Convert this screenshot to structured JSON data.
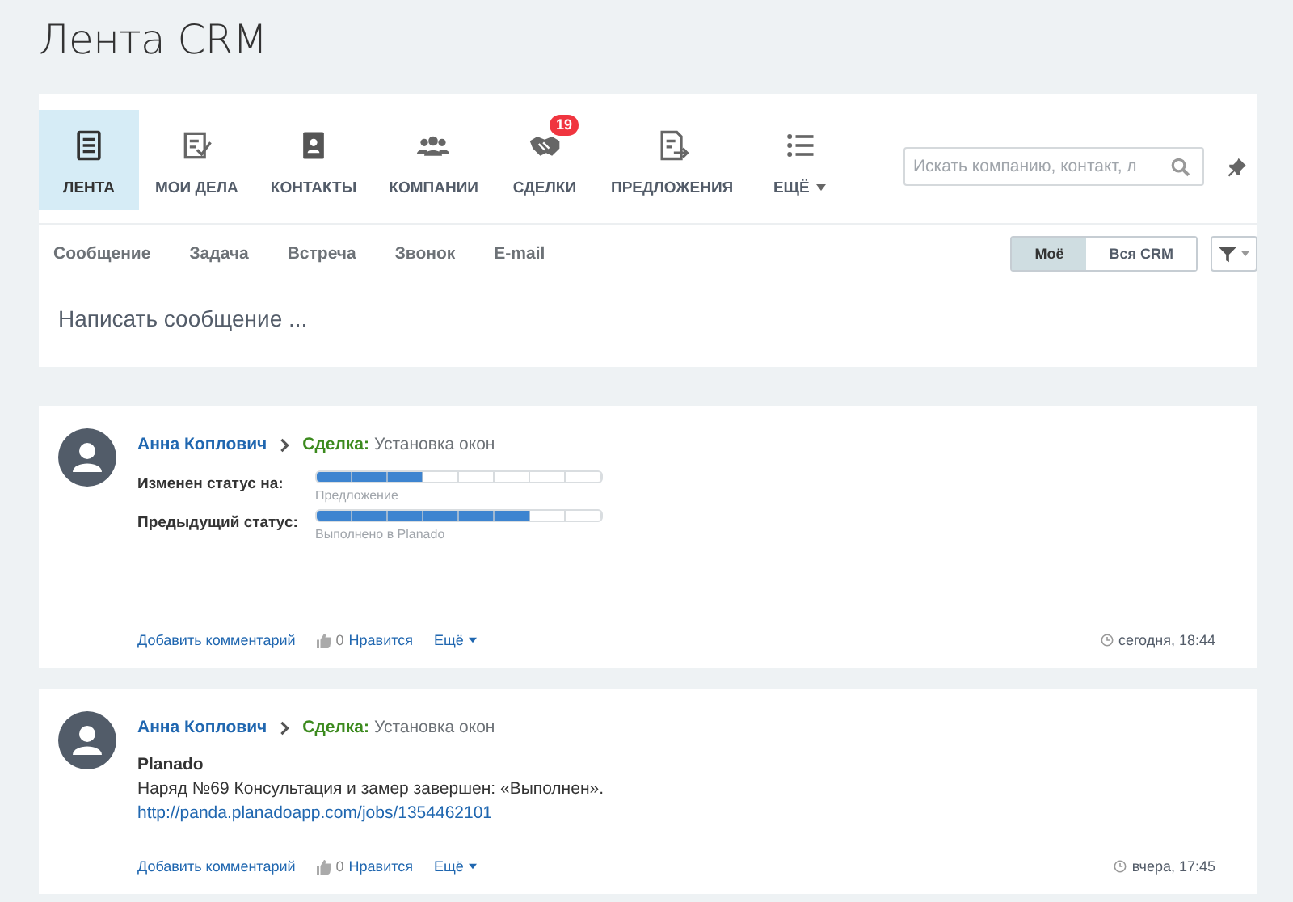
{
  "page_title": "Лента CRM",
  "nav": [
    {
      "label": "ЛЕНТА",
      "selected": true
    },
    {
      "label": "МОИ ДЕЛА",
      "selected": false
    },
    {
      "label": "КОНТАКТЫ",
      "selected": false
    },
    {
      "label": "КОМПАНИИ",
      "selected": false
    },
    {
      "label": "СДЕЛКИ",
      "selected": false,
      "badge": "19"
    },
    {
      "label": "ПРЕДЛОЖЕНИЯ",
      "selected": false
    },
    {
      "label": "ЕЩЁ",
      "selected": false,
      "dropdown": true
    }
  ],
  "search": {
    "placeholder": "Искать компанию, контакт, л"
  },
  "composer_tabs": [
    "Сообщение",
    "Задача",
    "Встреча",
    "Звонок",
    "E-mail"
  ],
  "scope": [
    {
      "label": "Моё",
      "selected": true
    },
    {
      "label": "Вся CRM",
      "selected": false
    }
  ],
  "composer": {
    "placeholder": "Написать сообщение ..."
  },
  "posts": [
    {
      "kind": "status",
      "author": "Анна Коплович",
      "entity_type": "Сделка:",
      "entity_name": "Установка окон",
      "statuses": [
        {
          "label": "Изменен статус на:",
          "level": 0.375,
          "name": "Предложение"
        },
        {
          "label": "Предыдущий статус:",
          "level": 0.75,
          "name": "Выполнено в Planado"
        }
      ],
      "comment": "Добавить комментарий",
      "likes": "0",
      "like": "Нравится",
      "more": "Ещё",
      "time": "сегодня, 18:44"
    },
    {
      "kind": "message",
      "author": "Анна Коплович",
      "entity_type": "Сделка:",
      "entity_name": "Установка окон",
      "title": "Planado",
      "text": "Наряд №69 Консультация и замер завершен: «Выполнен».",
      "link": "http://panda.planadoapp.com/jobs/1354462101",
      "comment": "Добавить комментарий",
      "likes": "0",
      "like": "Нравится",
      "more": "Ещё",
      "time": "вчера, 17:45"
    }
  ]
}
